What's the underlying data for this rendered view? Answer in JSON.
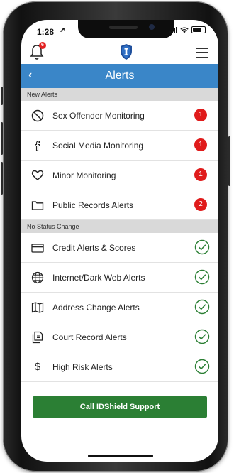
{
  "status_bar": {
    "time": "1:28"
  },
  "header": {
    "notification_count": "6"
  },
  "nav": {
    "title": "Alerts"
  },
  "sections": [
    {
      "label": "New Alerts",
      "items": [
        {
          "label": "Sex Offender Monitoring",
          "icon": "no-entry-icon",
          "count": "1"
        },
        {
          "label": "Social Media Monitoring",
          "icon": "facebook-icon",
          "count": "1"
        },
        {
          "label": "Minor Monitoring",
          "icon": "heart-icon",
          "count": "1"
        },
        {
          "label": "Public Records Alerts",
          "icon": "folder-icon",
          "count": "2"
        }
      ]
    },
    {
      "label": "No Status Change",
      "items": [
        {
          "label": "Credit Alerts & Scores",
          "icon": "credit-card-icon"
        },
        {
          "label": "Internet/Dark Web Alerts",
          "icon": "globe-icon"
        },
        {
          "label": "Address Change Alerts",
          "icon": "map-icon"
        },
        {
          "label": "Court Record Alerts",
          "icon": "documents-icon"
        },
        {
          "label": "High Risk Alerts",
          "icon": "dollar-icon"
        }
      ]
    }
  ],
  "cta": {
    "label": "Call IDShield Support"
  },
  "colors": {
    "nav": "#3a86c8",
    "badge": "#e01b1b",
    "check": "#2b7f34",
    "cta": "#2b7f34"
  }
}
